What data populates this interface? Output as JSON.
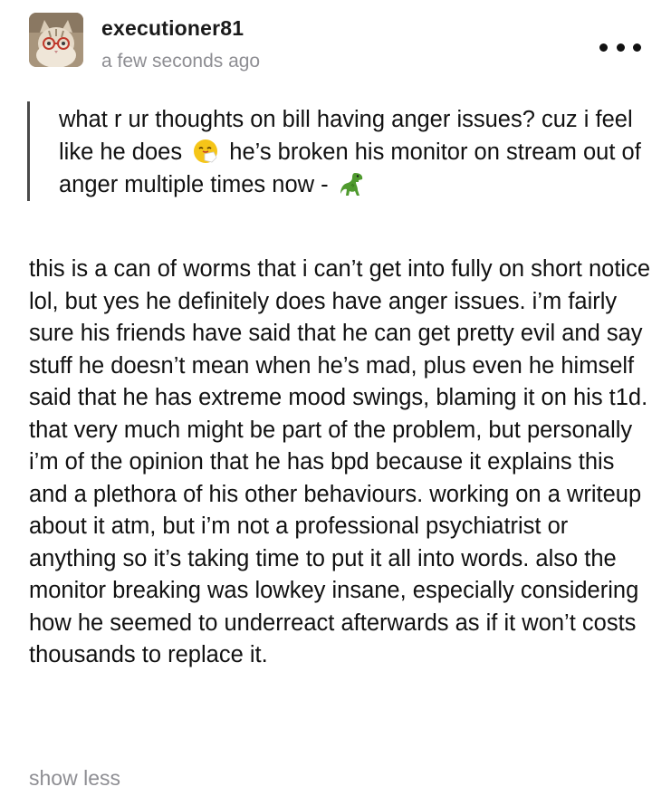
{
  "post": {
    "author": {
      "username": "executioner81",
      "timestamp": "a few seconds ago",
      "avatar_icon": "cat-with-glasses-avatar"
    },
    "more_icon": "ellipsis-icon",
    "ask": {
      "line_part1": "what r ur thoughts on bill having anger issues? cuz i feel like he does",
      "emoji_1": "sneezing-face-emoji",
      "line_part2": "he’s broken his monitor on stream out of anger multiple times now  -",
      "emoji_2": "t-rex-emoji"
    },
    "answer": {
      "text": "this is a can of worms that i can’t get into fully on short notice lol, but yes he definitely does have anger issues. i’m fairly sure his friends have said that he can get pretty evil and say stuff he doesn’t mean when he’s mad, plus even he himself said that he has extreme mood swings, blaming it on his t1d. that very much might be part of the problem, but personally i’m of the opinion that he has bpd because it explains this and a plethora of his other behaviours. working on a writeup about it atm, but i’m not a professional psychiatrist or anything so it’s taking time to put it all into words. also the monitor breaking was lowkey insane, especially considering how he seemed to underreact afterwards as if it won’t costs thousands to replace it."
    },
    "show_less_label": "show less",
    "colors": {
      "text": "#111111",
      "muted": "#8e8e93",
      "quote_bar": "#4a4a4a"
    }
  }
}
